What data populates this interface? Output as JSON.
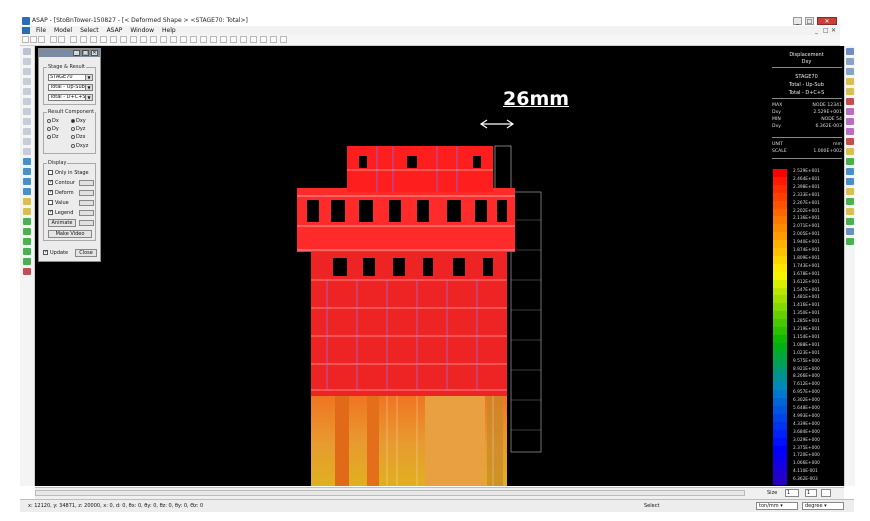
{
  "window": {
    "title": "ASAP - [StoBnTower-150827 - [< Deformed Shape > <STAGE70: Total>]",
    "controls": [
      "_",
      "□",
      "✕"
    ]
  },
  "menu": {
    "items": [
      "File",
      "Model",
      "Select",
      "ASAP",
      "Window",
      "Help"
    ]
  },
  "stage_panel": {
    "group_stage": "Stage & Result",
    "stage_value": "STAGE70",
    "result_value": "Total - Up-Sub",
    "total_value": "Total - D+C+S",
    "group_component": "Result Component",
    "radios": [
      {
        "label": "Dx",
        "on": false
      },
      {
        "label": "Dxy",
        "on": true
      },
      {
        "label": "Dy",
        "on": false
      },
      {
        "label": "Dyz",
        "on": false
      },
      {
        "label": "Dz",
        "on": false
      },
      {
        "label": "Dzx",
        "on": false
      },
      {
        "label": "Dxyz",
        "on": false
      }
    ],
    "group_display": "Display",
    "checks": [
      {
        "label": "Only in Stage",
        "on": false
      },
      {
        "label": "Contour",
        "on": true
      },
      {
        "label": "Deform",
        "on": true
      },
      {
        "label": "Value",
        "on": false
      },
      {
        "label": "Legend",
        "on": true
      }
    ],
    "animate_label": "Animate",
    "make_video_label": "Make Video",
    "update_label": "Update",
    "close_label": "Close"
  },
  "scale_label": "26mm",
  "legend": {
    "title1": "Displacement",
    "title2": "Dxy",
    "stage": "STAGE70",
    "case1": "Total - Up-Sub",
    "case2": "Total - D+C+S",
    "rows": [
      {
        "k": "MAX",
        "v": "NODE 12341"
      },
      {
        "k": "Dxy",
        "v": "2.529E+001"
      },
      {
        "k": "MIN",
        "v": "NODE 54"
      },
      {
        "k": "Dxy",
        "v": "6.362E-003"
      }
    ],
    "unit_k": "UNIT",
    "unit_v": "mm",
    "scale_k": "SCALE",
    "scale_v": "1.000E+002",
    "values": [
      "2.529E+001",
      "2.464E+001",
      "2.398E+001",
      "2.333E+001",
      "2.267E+001",
      "2.202E+001",
      "2.136E+001",
      "2.071E+001",
      "2.005E+001",
      "1.940E+001",
      "1.874E+001",
      "1.809E+001",
      "1.743E+001",
      "1.678E+001",
      "1.612E+001",
      "1.547E+001",
      "1.481E+001",
      "1.416E+001",
      "1.350E+001",
      "1.285E+001",
      "1.219E+001",
      "1.154E+001",
      "1.088E+001",
      "1.023E+001",
      "9.575E+000",
      "8.921E+000",
      "8.266E+000",
      "7.612E+000",
      "6.957E+000",
      "6.302E+000",
      "5.648E+000",
      "4.993E+000",
      "4.339E+000",
      "3.684E+000",
      "3.029E+000",
      "2.375E+000",
      "1.720E+000",
      "1.066E+000",
      "4.110E-001",
      "6.362E-003"
    ],
    "colors": [
      "#ff0000",
      "#ff1a00",
      "#ff2d00",
      "#ff4000",
      "#ff5200",
      "#ff6500",
      "#ff7800",
      "#ff8a00",
      "#ff9d00",
      "#ffb000",
      "#ffc200",
      "#ffd500",
      "#ffe800",
      "#f5f300",
      "#d9ef00",
      "#bce800",
      "#9fe000",
      "#82d800",
      "#65d000",
      "#48c800",
      "#2cc000",
      "#10b800",
      "#00b01a",
      "#00a83a",
      "#00a05a",
      "#00987a",
      "#00909a",
      "#0088ba",
      "#0078d0",
      "#0066d8",
      "#0055e0",
      "#0044e8",
      "#0033f0",
      "#0022f8",
      "#0011ff",
      "#0000ff",
      "#0a00f0",
      "#1400e0",
      "#1e00d0",
      "#2800c0"
    ]
  },
  "bottom": {
    "zoom_label": "Size",
    "zoom_value": "1",
    "page_value": "1"
  },
  "status": {
    "coords": "x: 12120, y: 34871, z: 20000, x: 0, d: 0, θx: 0, θy: 0, θz: 0, θy: 0, Θz: 0",
    "select_label": "Select",
    "unit_value": "ton/mm",
    "angle_value": "degree"
  }
}
